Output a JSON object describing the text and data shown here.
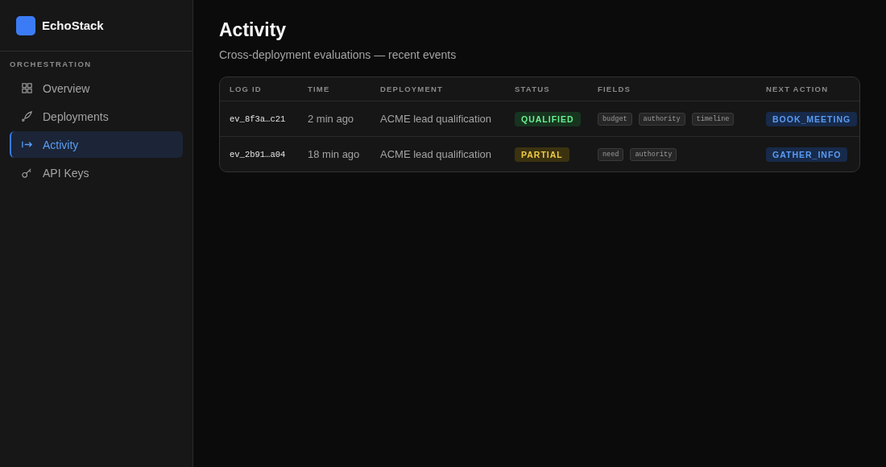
{
  "brand": {
    "name": "EchoStack"
  },
  "sidebar": {
    "section": "ORCHESTRATION",
    "items": [
      {
        "label": "Overview",
        "selected": false
      },
      {
        "label": "Deployments",
        "selected": false
      },
      {
        "label": "Activity",
        "selected": true
      },
      {
        "label": "API Keys",
        "selected": false
      }
    ]
  },
  "page": {
    "title": "Activity",
    "subtitle": "Cross-deployment evaluations — recent events"
  },
  "table": {
    "columns": [
      "LOG ID",
      "TIME",
      "DEPLOYMENT",
      "STATUS",
      "FIELDS",
      "NEXT ACTION"
    ],
    "rows": [
      {
        "log_id": "ev_8f3a…c21",
        "time": "2 min ago",
        "deployment": "ACME lead qualification",
        "status": {
          "label": "QUALIFIED",
          "color": "#17341f"
        },
        "fields": [
          "budget",
          "authority",
          "timeline"
        ],
        "next_action": "BOOK_MEETING"
      },
      {
        "log_id": "ev_2b91…a04",
        "time": "18 min ago",
        "deployment": "ACME lead qualification",
        "status": {
          "label": "PARTIAL",
          "color": "#3b3210"
        },
        "fields": [
          "need",
          "authority"
        ],
        "next_action": "GATHER_INFO"
      }
    ]
  }
}
